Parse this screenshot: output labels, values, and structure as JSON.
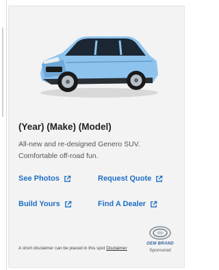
{
  "vehicle": {
    "title": "(Year) (Make) (Model)",
    "description": "All-new and re-designed Genero SUV. Comfortable off-road fun.",
    "image_icon": "suv-car-image",
    "body_color": "#8ec3ee"
  },
  "links": [
    {
      "label": "See Photos",
      "icon": "external-link-icon"
    },
    {
      "label": "Request Quote",
      "icon": "external-link-icon"
    },
    {
      "label": "Build Yours",
      "icon": "external-link-icon"
    },
    {
      "label": "Find A Dealer",
      "icon": "external-link-icon"
    }
  ],
  "disclaimer": {
    "text": "A short disclaimer can be placed in this spot",
    "link_label": "Disclaimer"
  },
  "brand": {
    "name": "OEM BRAND",
    "sponsored": "Sponsored",
    "color": "#2b5a9c"
  },
  "colors": {
    "link": "#1d6fc4",
    "card_bg": "#f3f3f3"
  }
}
